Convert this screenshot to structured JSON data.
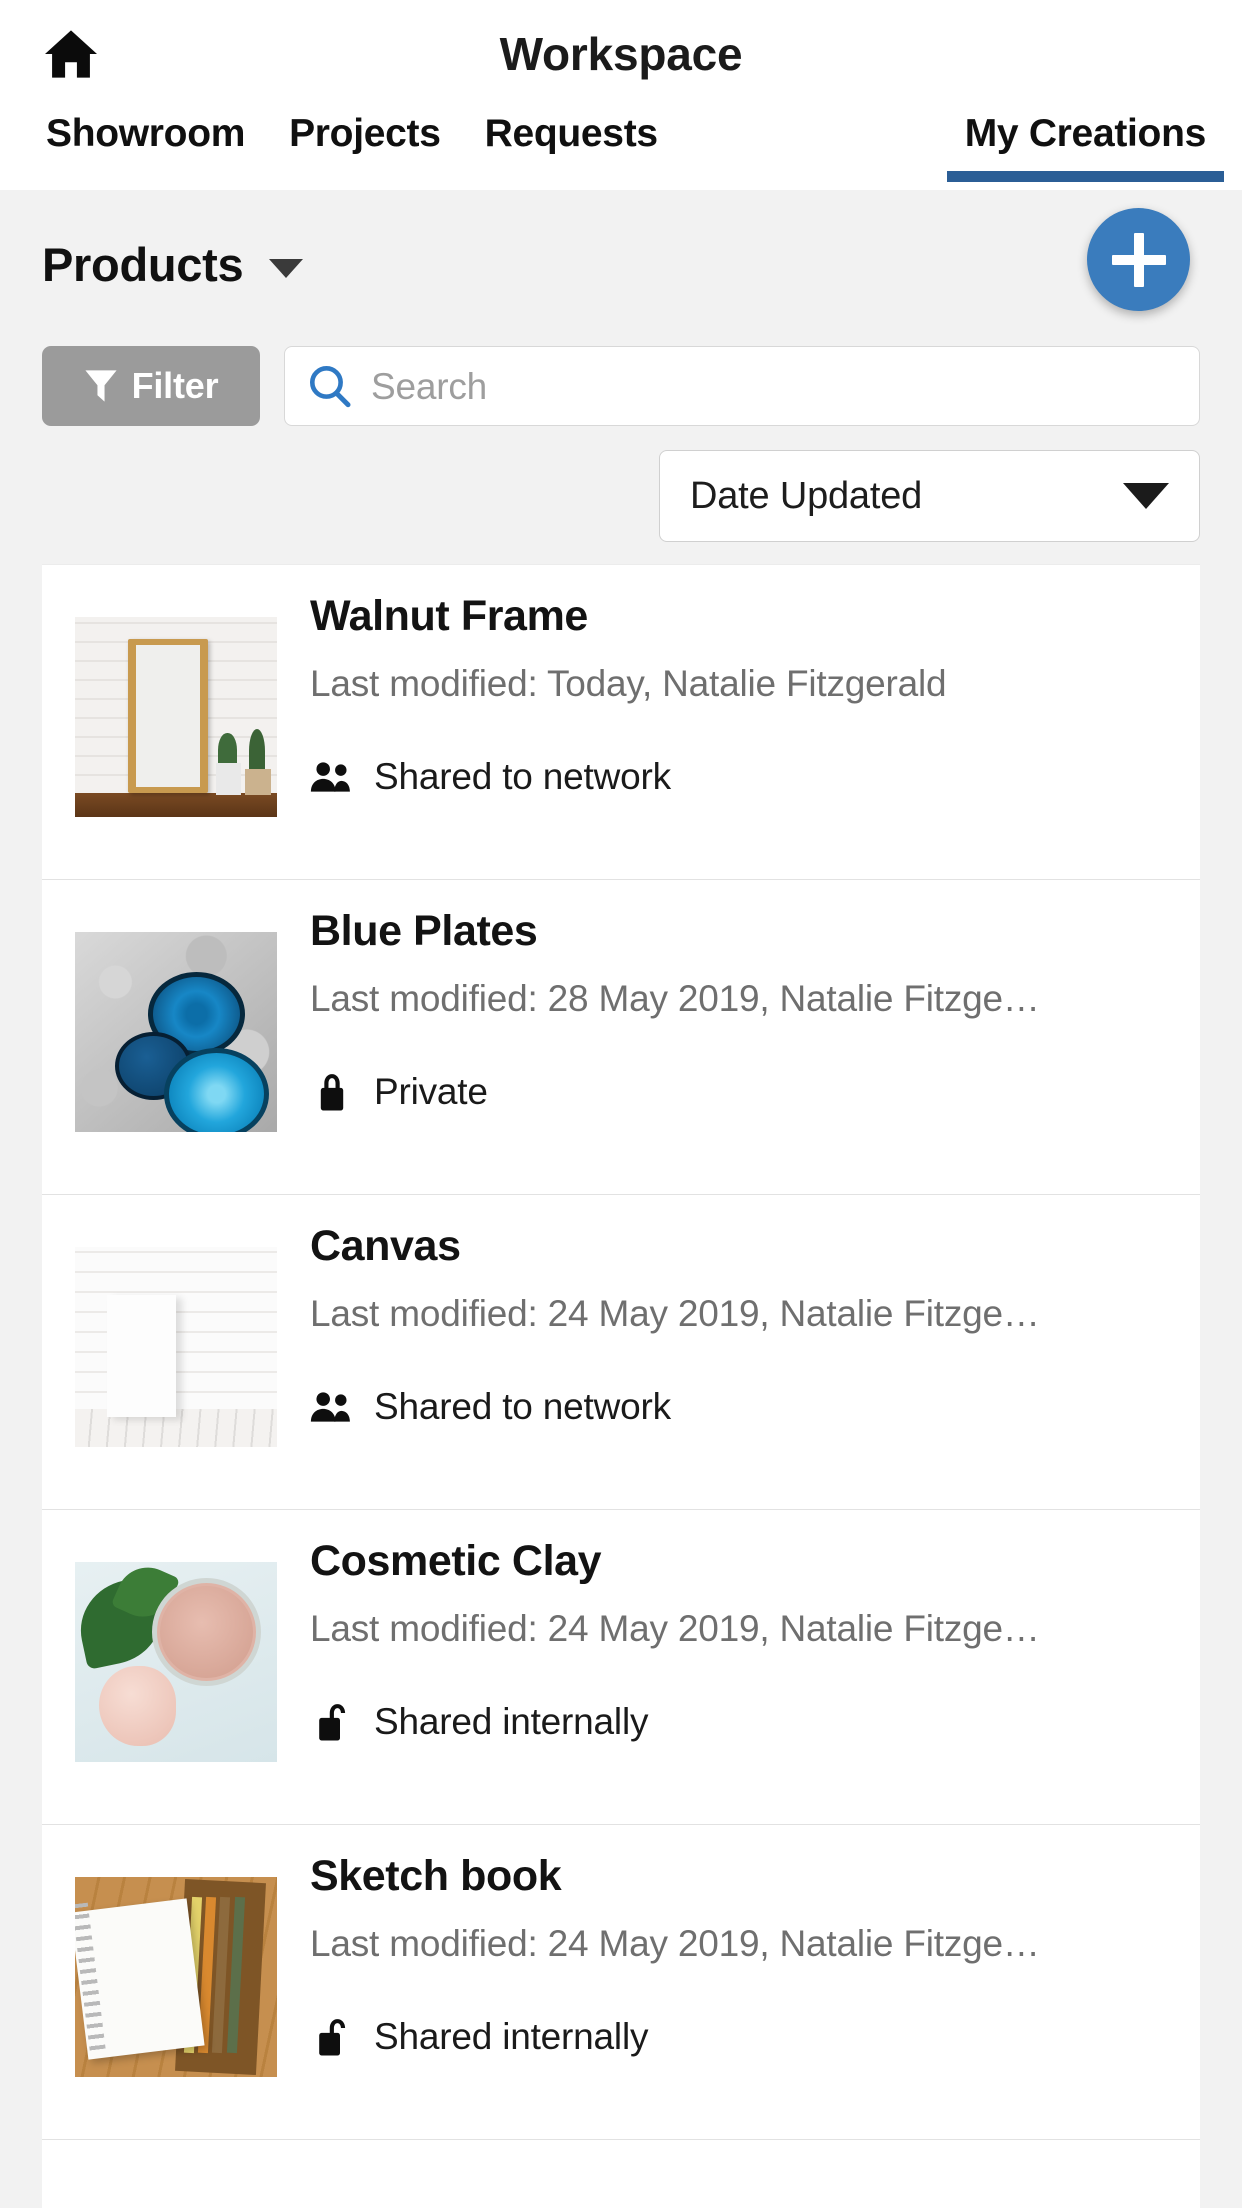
{
  "header": {
    "title": "Workspace",
    "home_icon": "home-icon"
  },
  "tabs": [
    {
      "label": "Showroom",
      "active": false
    },
    {
      "label": "Projects",
      "active": false
    },
    {
      "label": "Requests",
      "active": false
    },
    {
      "label": "My Creations",
      "active": true
    }
  ],
  "toolbar": {
    "section_title": "Products",
    "section_caret_icon": "chevron-down-icon",
    "add_button_icon": "plus-icon",
    "filter_label": "Filter",
    "filter_icon": "filter-funnel-icon",
    "search_placeholder": "Search",
    "search_value": "",
    "search_icon": "search-icon",
    "sort_value": "Date Updated",
    "sort_caret_icon": "chevron-down-icon"
  },
  "colors": {
    "accent_blue": "#3a7cbd",
    "active_tab_underline": "#2b5e96",
    "filter_gray": "#9b9b9b",
    "page_bg": "#f2f2f2",
    "card_bg": "#ffffff",
    "subtitle_gray": "#6f6f6f"
  },
  "list": {
    "items": [
      {
        "title": "Walnut Frame",
        "subtitle": "Last modified: Today, Natalie Fitzgerald",
        "status": "Shared to network",
        "status_icon": "people-icon",
        "thumb": "walnut-frame-thumbnail"
      },
      {
        "title": "Blue Plates",
        "subtitle": "Last modified: 28 May 2019, Natalie Fitzge…",
        "status": "Private",
        "status_icon": "lock-closed-icon",
        "thumb": "blue-plates-thumbnail"
      },
      {
        "title": "Canvas",
        "subtitle": "Last modified: 24 May 2019, Natalie Fitzge…",
        "status": "Shared to network",
        "status_icon": "people-icon",
        "thumb": "canvas-thumbnail"
      },
      {
        "title": "Cosmetic Clay",
        "subtitle": "Last modified: 24 May 2019, Natalie Fitzge…",
        "status": "Shared internally",
        "status_icon": "lock-open-icon",
        "thumb": "cosmetic-clay-thumbnail"
      },
      {
        "title": "Sketch book",
        "subtitle": "Last modified: 24 May 2019, Natalie Fitzge…",
        "status": "Shared internally",
        "status_icon": "lock-open-icon",
        "thumb": "sketch-book-thumbnail"
      }
    ]
  }
}
